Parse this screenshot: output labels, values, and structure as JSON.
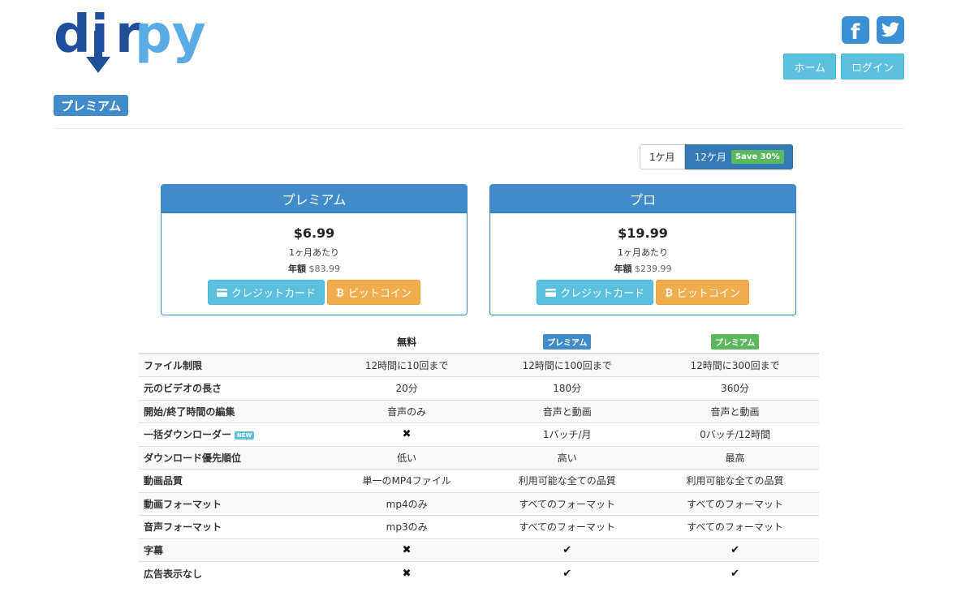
{
  "brand": {
    "logo_text": "dirpy",
    "logo_dark": "#1f4e9a",
    "logo_light": "#5aaae4"
  },
  "header": {
    "social": [
      {
        "icon": "facebook-icon",
        "glyph": "f"
      },
      {
        "icon": "twitter-icon",
        "glyph": "t"
      }
    ],
    "nav": {
      "home": "ホーム",
      "login": "ログイン"
    },
    "page_label": "プレミアム"
  },
  "billing_toggle": {
    "monthly": "1ケ月",
    "yearly": "12ケ月",
    "save_badge": "Save 30%",
    "selected": "yearly"
  },
  "plans": [
    {
      "name": "プレミアム",
      "price": "$6.99",
      "per_month": "1ヶ月あたり",
      "annual_label": "年額",
      "annual_price": "$83.99",
      "credit_card": "クレジットカード",
      "bitcoin": "ビットコイン"
    },
    {
      "name": "プロ",
      "price": "$19.99",
      "per_month": "1ヶ月あたり",
      "annual_label": "年額",
      "annual_price": "$239.99",
      "credit_card": "クレジットカード",
      "bitcoin": "ビットコイン"
    }
  ],
  "table": {
    "columns": [
      {
        "label": "無料",
        "badge": false
      },
      {
        "label": "プレミアム",
        "badge": true,
        "color": "#428bca"
      },
      {
        "label": "プレミアム",
        "badge": true,
        "color": "#5cb85c"
      }
    ],
    "new_badge": "NEW",
    "rows": [
      {
        "feature": "ファイル制限",
        "values": [
          "12時間に10回まで",
          "12時間に100回まで",
          "12時間に300回まで"
        ]
      },
      {
        "feature": "元のビデオの長さ",
        "values": [
          "20分",
          "180分",
          "360分"
        ]
      },
      {
        "feature": "開始/終了時間の編集",
        "values": [
          "音声のみ",
          "音声と動画",
          "音声と動画"
        ]
      },
      {
        "feature": "一括ダウンローダー",
        "is_new": true,
        "values": [
          "✖",
          "1バッチ/月",
          "0バッチ/12時間"
        ]
      },
      {
        "feature": "ダウンロード優先順位",
        "values": [
          "低い",
          "高い",
          "最高"
        ]
      },
      {
        "feature": "動画品質",
        "values": [
          "単一のMP4ファイル",
          "利用可能な全ての品質",
          "利用可能な全ての品質"
        ]
      },
      {
        "feature": "動画フォーマット",
        "values": [
          "mp4のみ",
          "すべてのフォーマット",
          "すべてのフォーマット"
        ]
      },
      {
        "feature": "音声フォーマット",
        "values": [
          "mp3のみ",
          "すべてのフォーマット",
          "すべてのフォーマット"
        ]
      },
      {
        "feature": "字幕",
        "values": [
          "✖",
          "✔",
          "✔"
        ]
      },
      {
        "feature": "広告表示なし",
        "values": [
          "✖",
          "✔",
          "✔"
        ]
      }
    ]
  }
}
